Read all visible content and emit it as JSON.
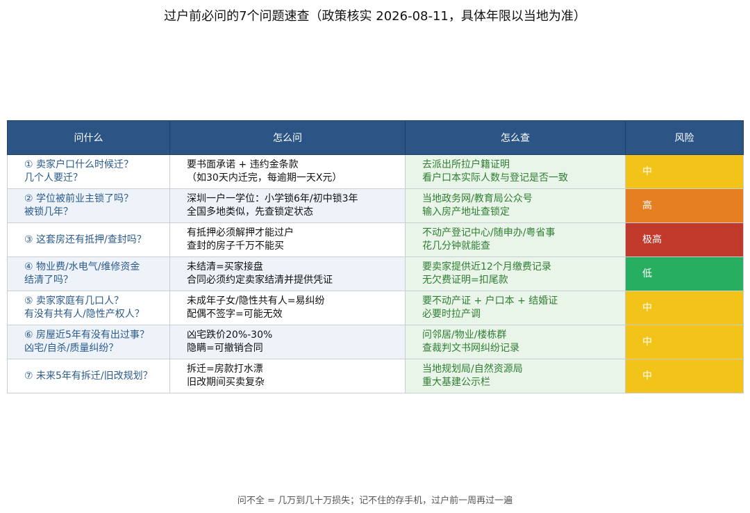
{
  "title": "过户前必问的7个问题速查（政策核实 2026-08-11，具体年限以当地为准）",
  "headers": [
    "问什么",
    "怎么问",
    "怎么查",
    "风险"
  ],
  "rows": [
    {
      "q": [
        "① 卖家户口什么时候迁？",
        "几个人要迁？"
      ],
      "how": [
        "要书面承诺 + 违约金条款",
        "（如30天内迁完，每逾期一天X元）"
      ],
      "check": [
        "去派出所拉户籍证明",
        "看户口本实际人数与登记是否一致"
      ],
      "risk": "中",
      "risk_color": "#f2c318"
    },
    {
      "q": [
        "② 学位被前业主锁了吗？",
        "被锁几年？"
      ],
      "how": [
        "深圳一户一学位：小学锁6年/初中锁3年",
        "全国多地类似，先查锁定状态"
      ],
      "check": [
        "当地政务网/教育局公众号",
        "输入房产地址查锁定"
      ],
      "risk": "高",
      "risk_color": "#e67e22"
    },
    {
      "q": [
        "③ 这套房还有抵押/查封吗？"
      ],
      "how": [
        "有抵押必须解押才能过户",
        "查封的房子千万不能买"
      ],
      "check": [
        "不动产登记中心/随申办/粤省事",
        "花几分钟就能查"
      ],
      "risk": "极高",
      "risk_color": "#c0392b"
    },
    {
      "q": [
        "④ 物业费/水电气/维修资金",
        "结清了吗？"
      ],
      "how": [
        "未结清=买家接盘",
        "合同必须约定卖家结清并提供凭证"
      ],
      "check": [
        "要卖家提供近12个月缴费记录",
        "无欠费证明=扣尾款"
      ],
      "risk": "低",
      "risk_color": "#27ae60"
    },
    {
      "q": [
        "⑤ 卖家家庭有几口人？",
        "有没有共有人/隐性产权人？"
      ],
      "how": [
        "未成年子女/隐性共有人=易纠纷",
        "配偶不签字=可能无效"
      ],
      "check": [
        "要不动产证 + 户口本 + 结婚证",
        "必要时拉产调"
      ],
      "risk": "中",
      "risk_color": "#f2c318"
    },
    {
      "q": [
        "⑥ 房屋近5年有没有出过事？",
        "凶宅/自杀/质量纠纷？"
      ],
      "how": [
        "凶宅跌价20%-30%",
        "隐瞒=可撤销合同"
      ],
      "check": [
        "问邻居/物业/楼栋群",
        "查裁判文书网纠纷记录"
      ],
      "risk": "中",
      "risk_color": "#f2c318"
    },
    {
      "q": [
        "⑦ 未来5年有拆迁/旧改规划？"
      ],
      "how": [
        "拆迁=房款打水漂",
        "旧改期间买卖复杂"
      ],
      "check": [
        "当地规划局/自然资源局",
        "重大基建公示栏"
      ],
      "risk": "中",
      "risk_color": "#f2c318"
    }
  ],
  "footer": "问不全 = 几万到几十万损失；记不住的存手机，过户前一周再过一遍"
}
